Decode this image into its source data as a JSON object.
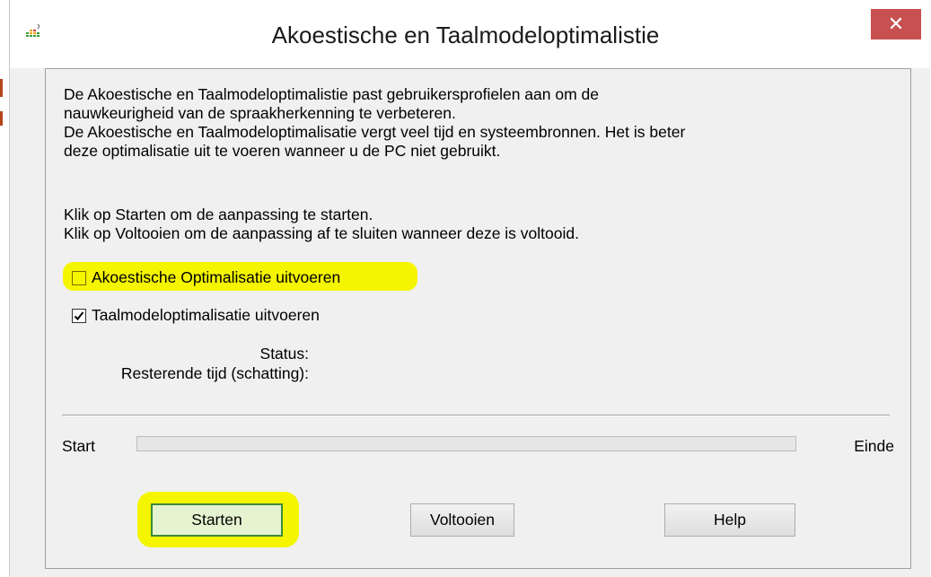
{
  "window": {
    "title": "Akoestische en Taalmodeloptimalistie",
    "close_label": "✕"
  },
  "description": {
    "paragraph1": "De Akoestische en Taalmodeloptimalistie past gebruikersprofielen aan om de\nnauwkeurigheid van de spraakherkenning te verbeteren.\nDe Akoestische en Taalmodeloptimalisatie vergt veel tijd en systeembronnen. Het is beter\ndeze optimalisatie uit te voeren wanneer u de PC niet gebruikt.",
    "paragraph2": "Klik op Starten om de aanpassing te starten.\nKlik op Voltooien om de aanpassing af te sluiten wanneer deze is voltooid."
  },
  "options": [
    {
      "label": "Akoestische Optimalisatie uitvoeren",
      "checked": false,
      "highlighted": true
    },
    {
      "label": "Taalmodeloptimalisatie uitvoeren",
      "checked": true,
      "highlighted": false
    }
  ],
  "status": {
    "status_label": "Status:",
    "remaining_label": "Resterende tijd (schatting):"
  },
  "progress": {
    "start_label": "Start",
    "end_label": "Einde",
    "value": 0
  },
  "buttons": {
    "start": "Starten",
    "finish": "Voltooien",
    "help": "Help"
  },
  "colors": {
    "highlight": "#f5f500",
    "close_button": "#c75050",
    "dialog_bg": "#f0f0f0"
  }
}
